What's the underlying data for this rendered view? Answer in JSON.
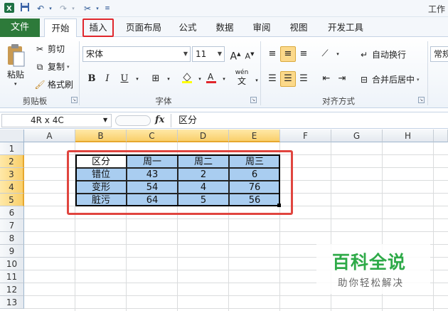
{
  "title_bar": {
    "app_title": "工作",
    "qa_save_icon": "save-icon",
    "qa_undo_icon": "undo-icon",
    "qa_redo_icon": "redo-icon",
    "qa_custom_icon": "tools-icon"
  },
  "tabs": [
    {
      "label": "文件"
    },
    {
      "label": "开始"
    },
    {
      "label": "插入"
    },
    {
      "label": "页面布局"
    },
    {
      "label": "公式"
    },
    {
      "label": "数据"
    },
    {
      "label": "审阅"
    },
    {
      "label": "视图"
    },
    {
      "label": "开发工具"
    }
  ],
  "ribbon": {
    "clipboard": {
      "paste": "粘贴",
      "cut": "剪切",
      "copy": "复制",
      "format_painter": "格式刷",
      "group": "剪贴板"
    },
    "font": {
      "name": "宋体",
      "size": "11",
      "bold": "B",
      "italic": "I",
      "underline": "U",
      "group": "字体",
      "grow": "A",
      "shrink": "A",
      "wen": "wén",
      "wen2": "文"
    },
    "alignment": {
      "wrap": "自动换行",
      "merge": "合并后居中",
      "group": "对齐方式"
    },
    "number": {
      "format": "常规"
    }
  },
  "formula_bar": {
    "name_box": "4R x 4C",
    "fx": "fx",
    "value": "区分"
  },
  "grid": {
    "columns": [
      "A",
      "B",
      "C",
      "D",
      "E",
      "F",
      "G",
      "H"
    ],
    "rows": [
      "1",
      "2",
      "3",
      "4",
      "5",
      "6",
      "7",
      "8",
      "9",
      "10",
      "11",
      "12",
      "13"
    ]
  },
  "table": {
    "header": [
      "区分",
      "周一",
      "周二",
      "周三"
    ],
    "rows": [
      [
        "错位",
        "43",
        "2",
        "6"
      ],
      [
        "变形",
        "54",
        "4",
        "76"
      ],
      [
        "脏污",
        "64",
        "5",
        "56"
      ]
    ]
  },
  "watermark": {
    "main": "百科全说",
    "sub": "助你轻松解决"
  },
  "colors": {
    "file_tab": "#2d7a3a",
    "highlight": "#e0262c",
    "selection_fill": "#a9cdf0",
    "watermark": "#2eaa48"
  }
}
